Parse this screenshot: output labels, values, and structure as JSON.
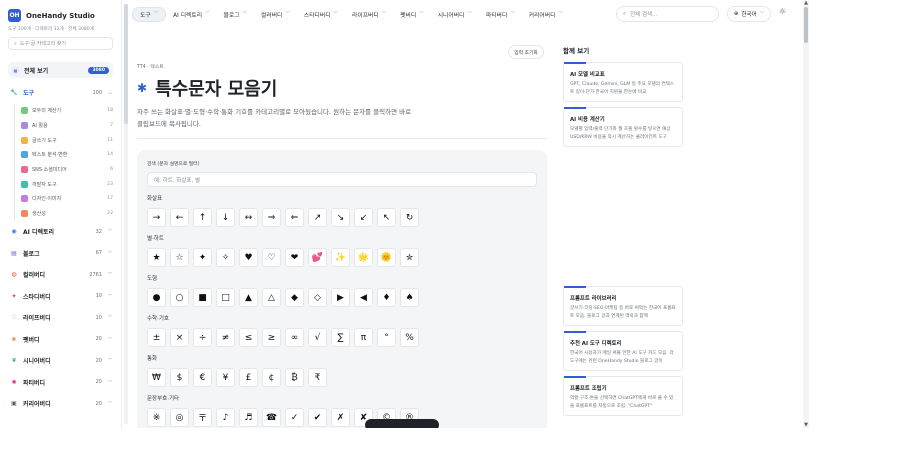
{
  "brand": {
    "name": "OneHandy Studio",
    "logo": "OH",
    "stats": "도구 100개 · 디렉토리 32개 · 전체 3080개"
  },
  "sidebar": {
    "search_placeholder": "도구·글·카테고리 찾기",
    "all": {
      "label": "전체 보기",
      "count": "3080"
    },
    "tool_category": {
      "label": "도구",
      "count": "100",
      "icon": "wrench-icon",
      "items": [
        {
          "label": "모두의 계산기",
          "count": "18",
          "color": "#7bc67e",
          "icon": "calculator-icon"
        },
        {
          "label": "AI 활용",
          "count": "7",
          "color": "#a98bd9",
          "icon": "sparkle-icon"
        },
        {
          "label": "글쓰기 도구",
          "count": "11",
          "color": "#f0b54a",
          "icon": "pen-icon"
        },
        {
          "label": "텍스트 분석·변환",
          "count": "14",
          "color": "#4fa3e0",
          "icon": "text-icon"
        },
        {
          "label": "SNS·소셜미디어",
          "count": "6",
          "color": "#e86a8a",
          "icon": "share-icon"
        },
        {
          "label": "개발자 도구",
          "count": "23",
          "color": "#3fbfa8",
          "icon": "code-icon"
        },
        {
          "label": "디자인·이미지",
          "count": "17",
          "color": "#c97be0",
          "icon": "palette-icon"
        },
        {
          "label": "생산성",
          "count": "22",
          "color": "#f08a5d",
          "icon": "check-icon"
        }
      ]
    },
    "categories": [
      {
        "label": "AI 디렉토리",
        "count": "32",
        "icon": "robot-icon",
        "color": "#3a7be0",
        "glyph": "◉"
      },
      {
        "label": "블로그",
        "count": "67",
        "icon": "book-icon",
        "color": "#6b5bd6",
        "glyph": "▤"
      },
      {
        "label": "컬러버디",
        "count": "2761",
        "icon": "palette-icon",
        "color": "#e0552f",
        "glyph": "◍"
      },
      {
        "label": "스타디버디",
        "count": "10",
        "icon": "star-icon",
        "color": "#e0452f",
        "glyph": "✦"
      },
      {
        "label": "라이프버디",
        "count": "10",
        "icon": "heart-icon",
        "color": "#3aa0e0",
        "glyph": "♡"
      },
      {
        "label": "펫버디",
        "count": "20",
        "icon": "paw-icon",
        "color": "#e08a2f",
        "glyph": "❀"
      },
      {
        "label": "시니어버디",
        "count": "20",
        "icon": "leaf-icon",
        "color": "#2fa36b",
        "glyph": "❦"
      },
      {
        "label": "파티버디",
        "count": "20",
        "icon": "party-icon",
        "color": "#e02f8a",
        "glyph": "✺"
      },
      {
        "label": "커리어버디",
        "count": "20",
        "icon": "briefcase-icon",
        "color": "#555c65",
        "glyph": "▣"
      }
    ]
  },
  "nav": {
    "tabs": [
      "도구",
      "AI 디렉토리",
      "블로그",
      "컬러버디",
      "스타디버디",
      "라이프버디",
      "펫버디",
      "시니어버디",
      "파티버디",
      "커리어버디"
    ],
    "search_placeholder": "전체 검색...",
    "language": "한국어"
  },
  "page": {
    "breadcrumb": "TT4 · 텍스트",
    "reset_label": "입력 초기화",
    "title": "특수문자 모음기",
    "description": "자주 쓰는 화살표·별·도형·수학·통화 기호를 카테고리별로 모아뒀습니다. 원하는 문자를 클릭하면 바로 클립보드에 복사됩니다.",
    "filter_label": "검색 (문자 설명으로 필터)",
    "filter_placeholder": "예: 하트, 화살표, 별",
    "groups": [
      {
        "label": "화살표",
        "glyphs": [
          "→",
          "←",
          "↑",
          "↓",
          "↔",
          "⇒",
          "⇐",
          "↗",
          "↘",
          "↙",
          "↖",
          "↻"
        ]
      },
      {
        "label": "별·하트",
        "glyphs": [
          "★",
          "☆",
          "✦",
          "✧",
          "♥",
          "♡",
          "❤",
          "💕",
          "✨",
          "🌟",
          "🌞",
          "✮"
        ]
      },
      {
        "label": "도형",
        "glyphs": [
          "●",
          "○",
          "■",
          "□",
          "▲",
          "△",
          "◆",
          "◇",
          "▶",
          "◀",
          "♦",
          "♠"
        ]
      },
      {
        "label": "수학·기호",
        "glyphs": [
          "±",
          "×",
          "÷",
          "≠",
          "≤",
          "≥",
          "∞",
          "√",
          "∑",
          "π",
          "°",
          "%"
        ]
      },
      {
        "label": "통화",
        "glyphs": [
          "₩",
          "$",
          "€",
          "¥",
          "£",
          "¢",
          "₿",
          "₹"
        ]
      },
      {
        "label": "문장부호·기타",
        "glyphs": [
          "※",
          "◎",
          "〒",
          "♪",
          "♬",
          "☎",
          "✓",
          "✔",
          "✗",
          "✘",
          "©",
          "®"
        ]
      }
    ]
  },
  "right": {
    "title": "함께 보기",
    "cards_top": [
      {
        "title": "AI 모델 비교표",
        "desc": "GPT, Claude, Gemini, GLM 등 주요 모델의 컨텍스트 길이·단가·한국어 지원을 한눈에 비교"
      },
      {
        "title": "AI 비용 계산기",
        "desc": "모델별 입력/출력 단가와 월 호출 횟수를 넣으면 예상 USD/KRW 비용을 즉시 계산하는 클라이언트 도구"
      }
    ],
    "cards_bottom": [
      {
        "title": "프롬프트 라이브러리",
        "desc": "글쓰기·코딩·SEO·마케팅 등 바로 써먹는 한국어 프롬프트 모음. 블로그 글과 연계된 맥락과 함께"
      },
      {
        "title": "추천 AI 도구 디렉토리",
        "desc": "한국어 사용자가 매일 써볼 만한 AI 도구 카드 모음. 각 도구에는 관련 OneHandy Studio 블로그 글이"
      },
      {
        "title": "프롬프트 조립기",
        "desc": "역할·구조·톤을 선택하면 ChatGPT에게 바로 쓸 수 있을 프롬프트를 자동으로 조립. \"ChatGPT\""
      }
    ]
  }
}
